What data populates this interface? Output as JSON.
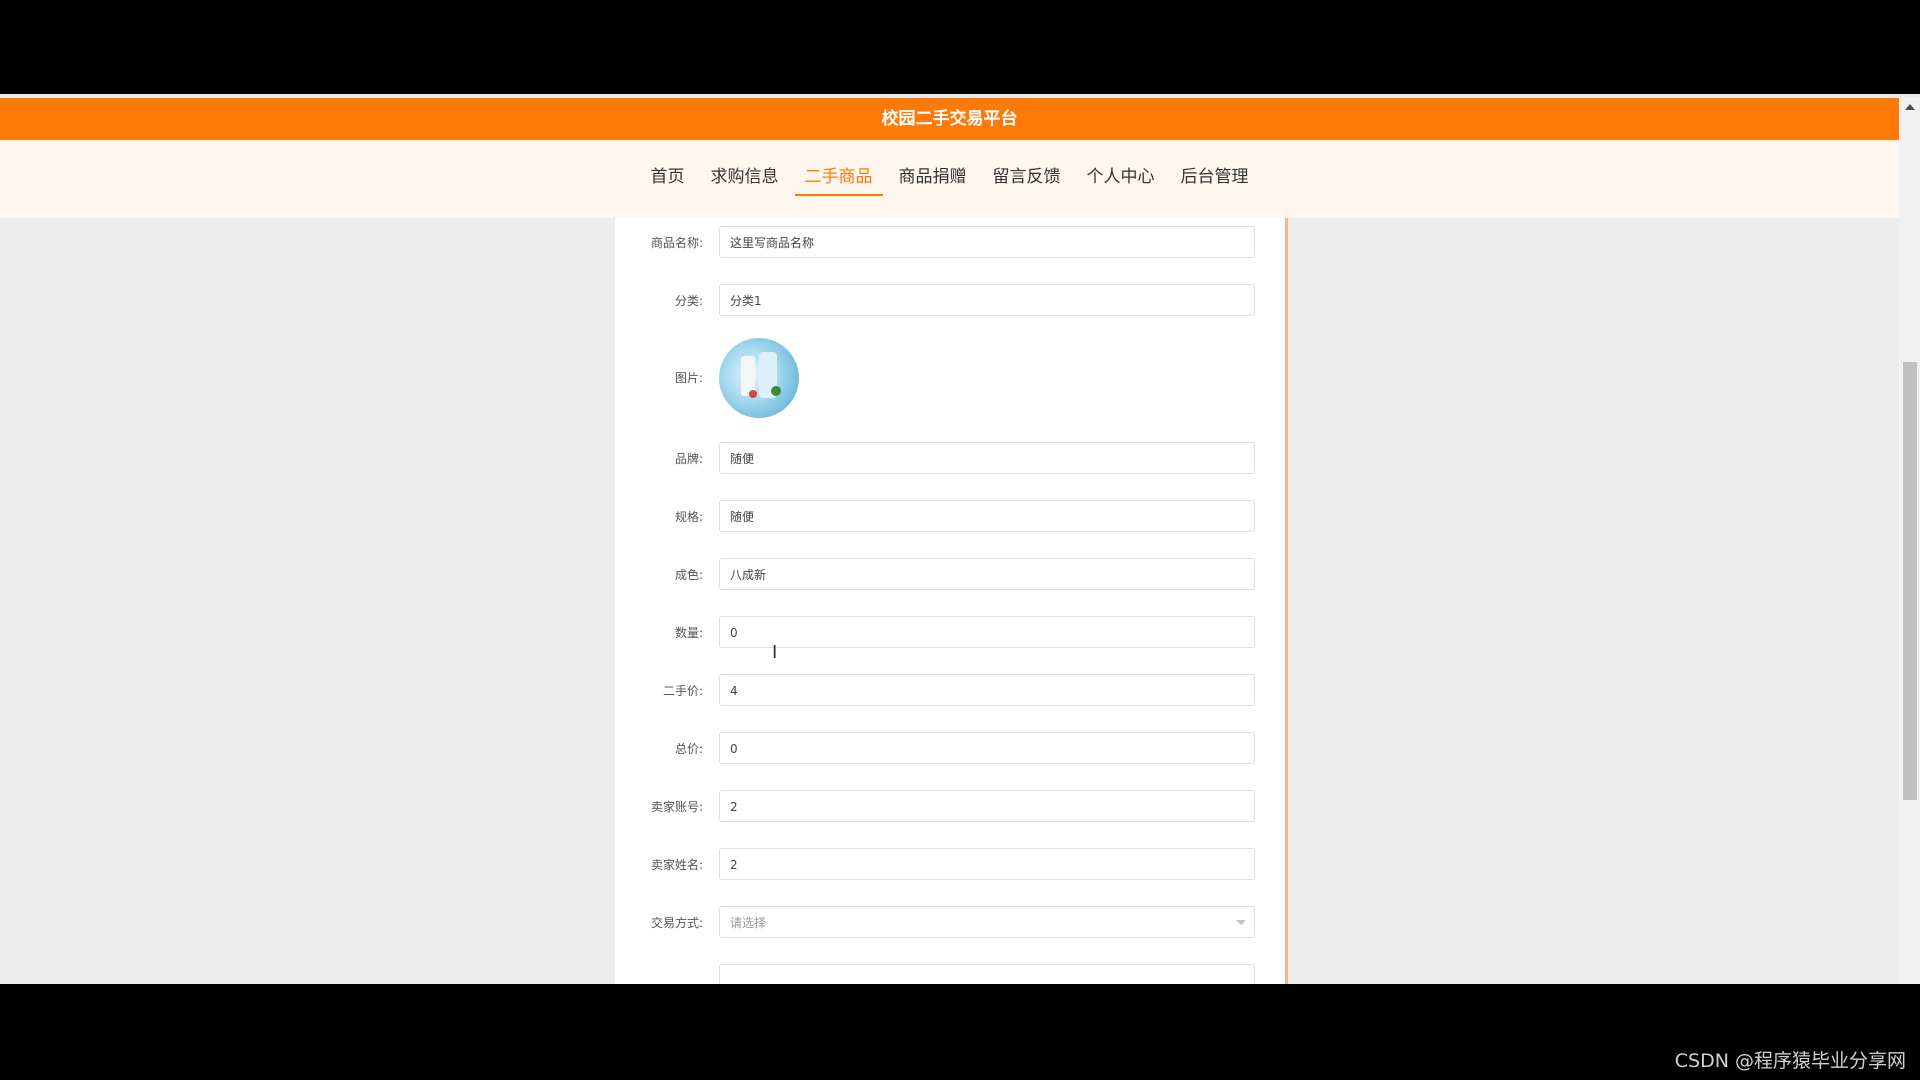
{
  "app_title": "校园二手交易平台",
  "nav": {
    "items": [
      "首页",
      "求购信息",
      "二手商品",
      "商品捐赠",
      "留言反馈",
      "个人中心",
      "后台管理"
    ],
    "active": "二手商品"
  },
  "form": {
    "name": {
      "label": "商品名称:",
      "value": "这里写商品名称"
    },
    "category": {
      "label": "分类:",
      "value": "分类1"
    },
    "image": {
      "label": "图片:"
    },
    "brand": {
      "label": "品牌:",
      "value": "随便"
    },
    "spec": {
      "label": "规格:",
      "value": "随便"
    },
    "condition": {
      "label": "成色:",
      "value": "八成新"
    },
    "quantity": {
      "label": "数量:",
      "value": "0"
    },
    "used_price": {
      "label": "二手价:",
      "value": "4"
    },
    "total_price": {
      "label": "总价:",
      "value": "0"
    },
    "seller_account": {
      "label": "卖家账号:",
      "value": "2"
    },
    "seller_name": {
      "label": "卖家姓名:",
      "value": "2"
    },
    "trade_method": {
      "label": "交易方式:",
      "placeholder": "请选择"
    }
  },
  "watermark": "CSDN @程序猿毕业分享网",
  "colors": {
    "accent": "#ff7a08",
    "nav_bg": "#fff6ee",
    "panel_border": "#f6b48a"
  }
}
